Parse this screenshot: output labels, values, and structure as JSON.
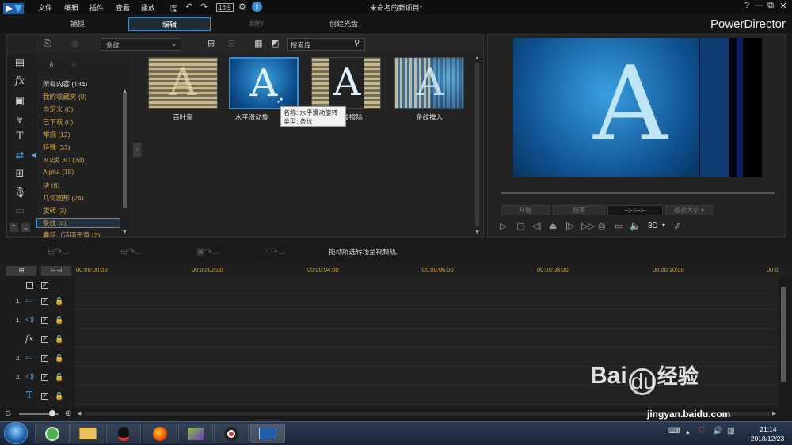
{
  "menu": [
    "文件",
    "编辑",
    "插件",
    "查看",
    "播放"
  ],
  "title": "未命名的新项目*",
  "window_buttons": [
    "?",
    "—",
    "⧉",
    "✕"
  ],
  "modes": [
    {
      "label": "捕捉",
      "state": "normal"
    },
    {
      "label": "编辑",
      "state": "active"
    },
    {
      "label": "制作",
      "state": "disabled"
    },
    {
      "label": "创建光盘",
      "state": "normal"
    }
  ],
  "brand": "PowerDirector",
  "library": {
    "dropdown_value": "条纹",
    "search_placeholder": "搜索库",
    "categories": [
      {
        "label": "所有内容 (134)",
        "color": "white"
      },
      {
        "label": "我的收藏夹  (0)",
        "color": "gold"
      },
      {
        "label": "自定义  (0)",
        "color": "gold"
      },
      {
        "label": "已下载  (0)",
        "color": "gold"
      },
      {
        "label": "常规  (12)",
        "color": "gold"
      },
      {
        "label": "特殊  (33)",
        "color": "gold"
      },
      {
        "label": "3D/类 3D  (34)",
        "color": "gold"
      },
      {
        "label": "Alpha  (15)",
        "color": "gold"
      },
      {
        "label": "块  (6)",
        "color": "gold"
      },
      {
        "label": "几何图形  (24)",
        "color": "gold"
      },
      {
        "label": "旋转  (3)",
        "color": "gold"
      },
      {
        "label": "条纹  (4)",
        "color": "gold"
      },
      {
        "label": "囊括（活用于意   (2)",
        "color": "gold"
      }
    ],
    "selected_category": "条纹  (4)",
    "transitions": [
      {
        "label": "百叶窗",
        "glyph": "A"
      },
      {
        "label": "水平滑动旋",
        "glyph": "A"
      },
      {
        "label": "较擦除",
        "glyph": "A"
      },
      {
        "label": "条纹推入",
        "glyph": "A"
      }
    ],
    "tooltip": {
      "name": "名称: 水平滑动旋转",
      "type": "类型: 条纹"
    }
  },
  "preview": {
    "glyph": "A",
    "timecode": "--:--:--:--",
    "buttons": [
      "开始",
      "结束"
    ],
    "zoom_label": "适合大小",
    "mode3d": "3D"
  },
  "timeline": {
    "status": "拖动所选转场至视频轨。",
    "ticks": [
      "00:00:00:00",
      "00:00:02:00",
      "00:00:04:00",
      "00:00:06:00",
      "00:00:08:00",
      "00:00:10:00",
      "00:0"
    ],
    "tracks": [
      {
        "label": "",
        "icon": "none"
      },
      {
        "label": "1.",
        "icon": "video-icon"
      },
      {
        "label": "1.",
        "icon": "audio-icon"
      },
      {
        "label": "fx",
        "icon": "fx-icon"
      },
      {
        "label": "2.",
        "icon": "video-icon"
      },
      {
        "label": "2.",
        "icon": "audio-icon"
      },
      {
        "label": "T",
        "icon": "title-icon"
      }
    ]
  },
  "taskbar": {
    "time": "21:14",
    "date": "2018/12/23"
  },
  "watermark": {
    "logo_text": "Bai",
    "logo_cn": "经验",
    "url": "jingyan.baidu.com"
  },
  "colors": {
    "accent": "#3a8fd0",
    "category_text": "#c9a34a",
    "background": "#1b1b1b"
  }
}
